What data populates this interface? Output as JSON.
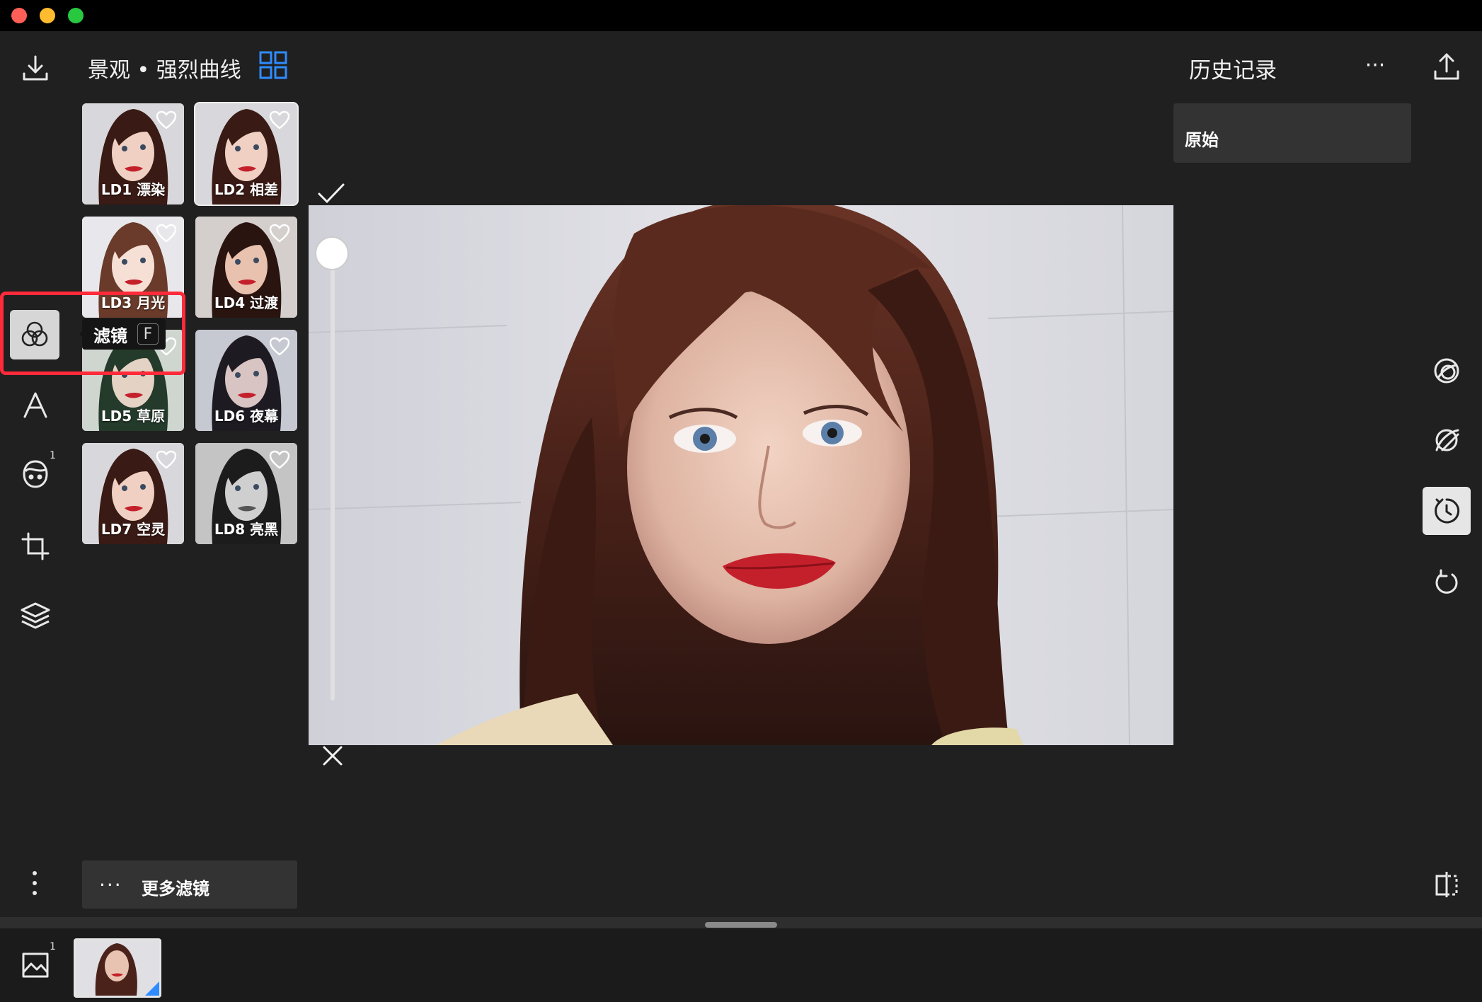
{
  "window": {
    "controls": [
      "close",
      "minimize",
      "maximize"
    ]
  },
  "header": {
    "title": "景观 • 强烈曲线",
    "history_title": "历史记录",
    "more": "···"
  },
  "filters": [
    {
      "label": "LD1 漂染",
      "tone": "normal"
    },
    {
      "label": "LD2 相差",
      "tone": "normal",
      "selected": true
    },
    {
      "label": "LD3 月光",
      "tone": "bright"
    },
    {
      "label": "LD4 过渡",
      "tone": "warm"
    },
    {
      "label": "LD5 草原",
      "tone": "green"
    },
    {
      "label": "LD6 夜幕",
      "tone": "cool"
    },
    {
      "label": "LD7 空灵",
      "tone": "normal"
    },
    {
      "label": "LD8 亮黑",
      "tone": "mono"
    }
  ],
  "tooltip": {
    "label": "滤镜",
    "shortcut": "F"
  },
  "history": {
    "items": [
      "原始"
    ]
  },
  "more_filters": {
    "dots": "···",
    "label": "更多滤镜"
  },
  "badges": {
    "face_count": "1",
    "image_count": "1"
  },
  "left_tools": [
    "download-icon",
    "filters-icon",
    "text-icon",
    "face-icon",
    "crop-icon",
    "layers-icon",
    "more-vertical-icon"
  ],
  "right_tools": [
    "share-icon",
    "mask-icon",
    "brush-erase-icon",
    "history-timer-icon",
    "undo-icon",
    "compare-icon"
  ],
  "colors": {
    "accent_blue": "#2f8cff",
    "highlight_red": "#ff2a3a",
    "background": "#202020"
  }
}
